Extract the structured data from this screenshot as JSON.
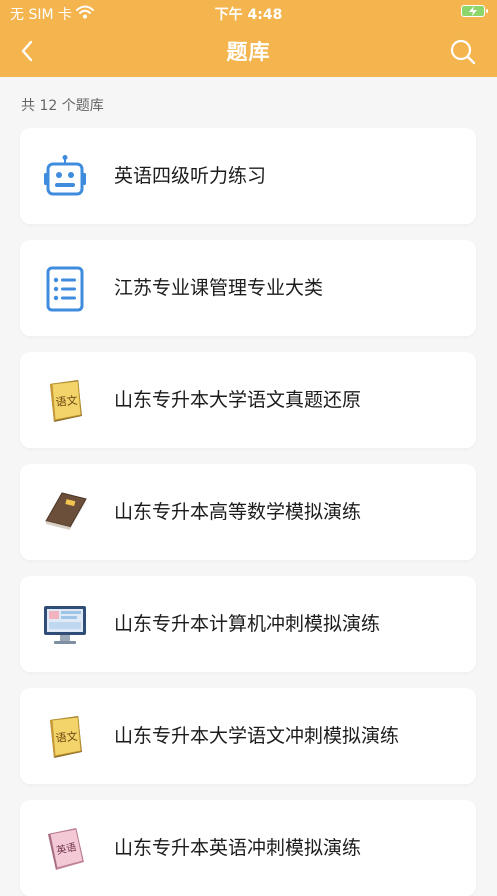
{
  "status_bar": {
    "carrier": "无 SIM 卡",
    "time": "下午 4:48"
  },
  "nav": {
    "title": "题库"
  },
  "count_label": "共 12 个题库",
  "items": [
    {
      "title": "英语四级听力练习",
      "icon": "robot-icon"
    },
    {
      "title": "江苏专业课管理专业大类",
      "icon": "list-icon"
    },
    {
      "title": "山东专升本大学语文真题还原",
      "icon": "chinese-book-icon"
    },
    {
      "title": "山东专升本高等数学模拟演练",
      "icon": "math-book-icon"
    },
    {
      "title": "山东专升本计算机冲刺模拟演练",
      "icon": "computer-icon"
    },
    {
      "title": " 山东专升本大学语文冲刺模拟演练",
      "icon": "chinese-book-icon"
    },
    {
      "title": "山东专升本英语冲刺模拟演练",
      "icon": "english-book-icon"
    }
  ],
  "colors": {
    "header": "#f4b44e",
    "accent_blue": "#3f8cde"
  }
}
